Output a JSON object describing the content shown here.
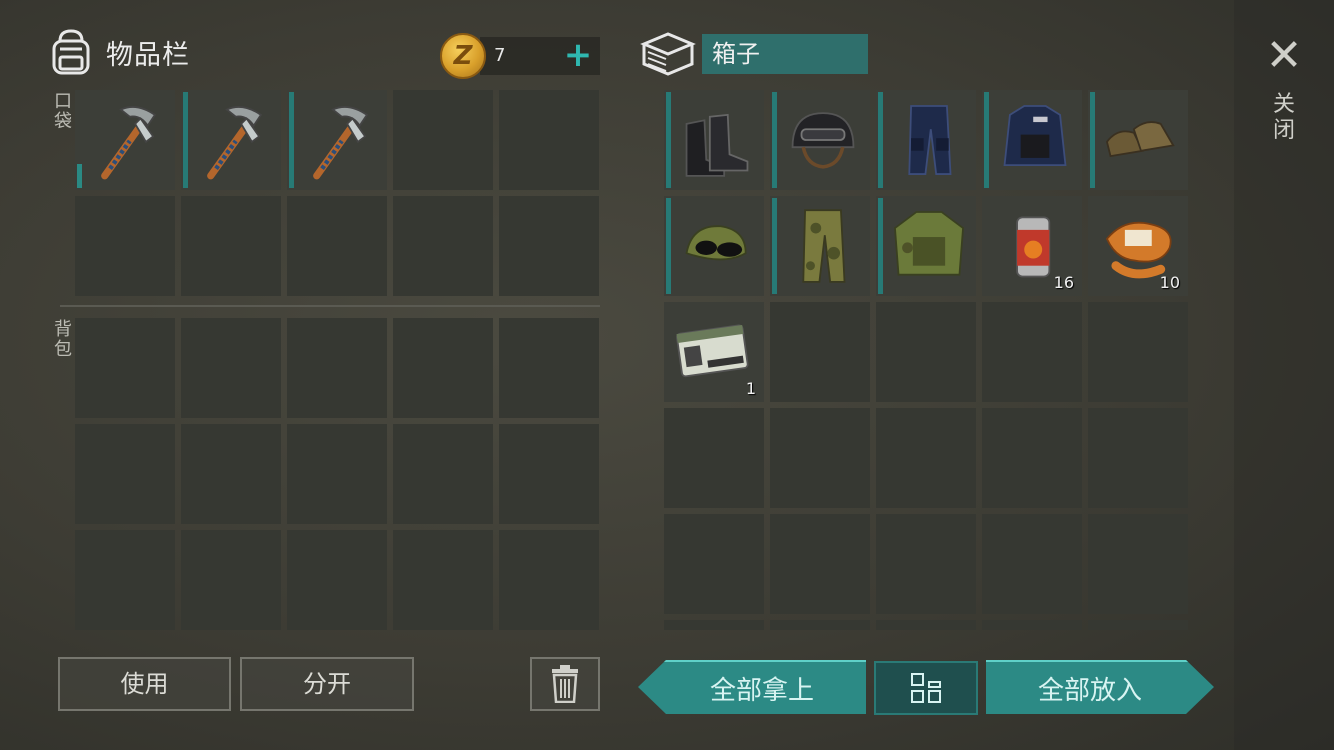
{
  "inventory": {
    "title": "物品栏",
    "coins": "7",
    "pocket_label": "口袋",
    "backpack_label": "背包",
    "pocket_slots": [
      {
        "item": "pickaxe-icon",
        "filled": true
      },
      {
        "item": "pickaxe-icon",
        "filled": true
      },
      {
        "item": "pickaxe-icon",
        "filled": true
      },
      {
        "item": "",
        "filled": false
      },
      {
        "item": "",
        "filled": false
      },
      {
        "item": "",
        "filled": false
      },
      {
        "item": "",
        "filled": false
      },
      {
        "item": "",
        "filled": false
      },
      {
        "item": "",
        "filled": false
      },
      {
        "item": "",
        "filled": false
      }
    ],
    "backpack_slot_count": 15
  },
  "box": {
    "title": "箱子",
    "items": [
      {
        "item": "boots-icon",
        "qty": ""
      },
      {
        "item": "helmet-icon",
        "qty": ""
      },
      {
        "item": "police-pants-icon",
        "qty": ""
      },
      {
        "item": "police-vest-icon",
        "qty": ""
      },
      {
        "item": "shoes-icon",
        "qty": ""
      },
      {
        "item": "camo-cap-icon",
        "qty": ""
      },
      {
        "item": "camo-pants-icon",
        "qty": ""
      },
      {
        "item": "camo-vest-icon",
        "qty": ""
      },
      {
        "item": "canned-food-icon",
        "qty": "16"
      },
      {
        "item": "fur-icon",
        "qty": "10"
      },
      {
        "item": "army-id-card-icon",
        "qty": "1"
      }
    ]
  },
  "buttons": {
    "use": "使用",
    "split": "分开",
    "take_all": "全部拿上",
    "put_all": "全部放入",
    "close": "关闭"
  },
  "colors": {
    "accent": "#2c8a85",
    "slot_bg": "#363832",
    "durability_bar": "#277a76"
  }
}
